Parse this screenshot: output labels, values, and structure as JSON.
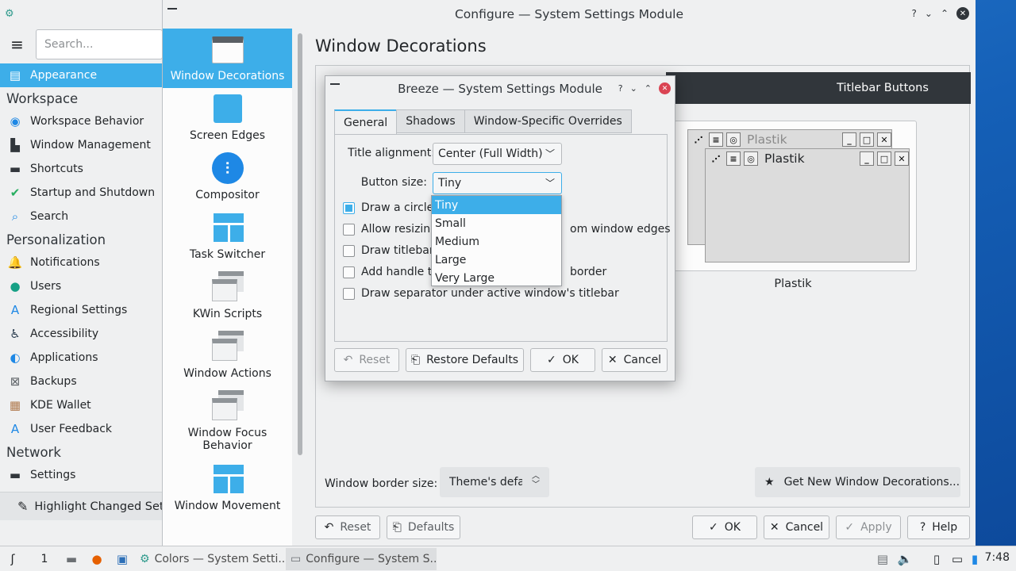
{
  "back_window": {
    "search_placeholder": "Search...",
    "categories": [
      {
        "type": "item",
        "label": "Appearance",
        "icon": "appearance-icon",
        "active": true
      },
      {
        "type": "header",
        "label": "Workspace"
      },
      {
        "type": "item",
        "label": "Workspace Behavior",
        "icon": "workspace-behavior-icon"
      },
      {
        "type": "item",
        "label": "Window Management",
        "icon": "window-management-icon"
      },
      {
        "type": "item",
        "label": "Shortcuts",
        "icon": "shortcuts-icon"
      },
      {
        "type": "item",
        "label": "Startup and Shutdown",
        "icon": "startup-shutdown-icon"
      },
      {
        "type": "item",
        "label": "Search",
        "icon": "search-icon"
      },
      {
        "type": "header",
        "label": "Personalization"
      },
      {
        "type": "item",
        "label": "Notifications",
        "icon": "bell-icon"
      },
      {
        "type": "item",
        "label": "Users",
        "icon": "user-icon"
      },
      {
        "type": "item",
        "label": "Regional Settings",
        "icon": "regional-settings-icon"
      },
      {
        "type": "item",
        "label": "Accessibility",
        "icon": "accessibility-icon"
      },
      {
        "type": "item",
        "label": "Applications",
        "icon": "applications-icon"
      },
      {
        "type": "item",
        "label": "Backups",
        "icon": "backups-icon"
      },
      {
        "type": "item",
        "label": "KDE Wallet",
        "icon": "wallet-icon"
      },
      {
        "type": "item",
        "label": "User Feedback",
        "icon": "feedback-icon"
      },
      {
        "type": "header",
        "label": "Network"
      },
      {
        "type": "item",
        "label": "Settings",
        "icon": "network-settings-icon"
      }
    ],
    "highlight_label": "Highlight Changed Settings"
  },
  "configure_window": {
    "title": "Configure — System Settings Module",
    "controls": {
      "help": "?",
      "minimize": "⌄",
      "maximize": "⌃",
      "close": "✕"
    },
    "kcm_items": [
      {
        "label": "Window Decorations",
        "icon": "window-decorations-icon",
        "active": true
      },
      {
        "label": "Screen Edges",
        "icon": "screen-edges-icon"
      },
      {
        "label": "Compositor",
        "icon": "compositor-icon"
      },
      {
        "label": "Task Switcher",
        "icon": "task-switcher-icon"
      },
      {
        "label": "KWin Scripts",
        "icon": "kwin-scripts-icon"
      },
      {
        "label": "Window Actions",
        "icon": "window-actions-icon"
      },
      {
        "label": "Window Focus Behavior",
        "icon": "window-focus-icon"
      },
      {
        "label": "Window Movement",
        "icon": "window-movement-icon"
      }
    ],
    "page_title": "Window Decorations",
    "titlebar_buttons_tab": "Titlebar Buttons",
    "preview": {
      "title_back": "Plastik",
      "title_front": "Plastik",
      "caption": "Plastik"
    },
    "border_size_label": "Window border size:",
    "border_size_value": "Theme's default",
    "get_new_label": "Get New Window Decorations...",
    "bottom_buttons": {
      "reset": "Reset",
      "defaults": "Defaults",
      "ok": "OK",
      "cancel": "Cancel",
      "apply": "Apply",
      "help": "Help"
    }
  },
  "breeze_dialog": {
    "title": "Breeze — System Settings Module",
    "controls": {
      "help": "?",
      "minimize": "⌄",
      "maximize": "⌃",
      "close": "✕"
    },
    "tabs": [
      "General",
      "Shadows",
      "Window-Specific Overrides"
    ],
    "active_tab": "General",
    "title_alignment_label": "Title alignment:",
    "title_alignment_value": "Center (Full Width)",
    "button_size_label": "Button size:",
    "button_size_value": "Tiny",
    "button_size_options": [
      "Tiny",
      "Small",
      "Medium",
      "Large",
      "Very Large"
    ],
    "checkboxes": [
      {
        "visible_left": "Draw a circle",
        "checked": true
      },
      {
        "visible_left": "Allow resizing",
        "visible_right": "om window edges",
        "checked": false
      },
      {
        "visible_left": "Draw titlebar",
        "checked": false
      },
      {
        "visible_left": "Add handle to",
        "visible_right": "border",
        "checked": false
      },
      {
        "visible_left": "Draw separator under active window's titlebar",
        "checked": false
      }
    ],
    "buttons": {
      "reset": "Reset",
      "restore_defaults": "Restore Defaults",
      "ok": "OK",
      "cancel": "Cancel"
    }
  },
  "taskbar": {
    "desktop_number": "1",
    "tasks": [
      {
        "label": "Colors — System Setti...",
        "icon": "system-settings-icon"
      },
      {
        "label": "Configure — System S...",
        "icon": "configure-icon"
      }
    ],
    "clock": "7:48"
  },
  "colors": {
    "accent": "#3daee9",
    "titlebar_dark": "#31363b",
    "close_red": "#da4453",
    "desktop_blue": "#1d6ec7"
  }
}
